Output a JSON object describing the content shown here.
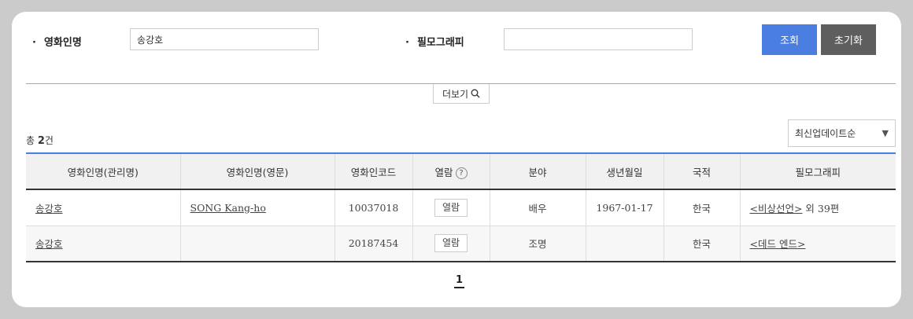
{
  "search": {
    "name_label": "영화인명",
    "name_value": "송강호",
    "filmo_label": "필모그래피",
    "filmo_value": "",
    "search_button": "조회",
    "reset_button": "초기화"
  },
  "more": {
    "label": "더보기",
    "icon": "search-icon"
  },
  "summary": {
    "prefix": "총",
    "count": "2",
    "suffix": "건"
  },
  "sort": {
    "selected": "최신업데이트순",
    "icon": "triangle-down-icon"
  },
  "table": {
    "headers": [
      "영화인명(관리명)",
      "영화인명(영문)",
      "영화인코드",
      "열람",
      "분야",
      "생년월일",
      "국적",
      "필모그래피"
    ],
    "help_icon": "?",
    "rows": [
      {
        "name": "송강호",
        "name_en": "SONG Kang-ho",
        "code": "10037018",
        "view": "열람",
        "field": "배우",
        "birth": "1967-01-17",
        "nation": "한국",
        "filmo_link": "<비상선언>",
        "filmo_extra": " 외 39편"
      },
      {
        "name": "송강호",
        "name_en": "",
        "code": "20187454",
        "view": "열람",
        "field": "조명",
        "birth": "",
        "nation": "한국",
        "filmo_link": "<데드 엔드>",
        "filmo_extra": ""
      }
    ]
  },
  "pagination": {
    "current": "1"
  },
  "colors": {
    "accent": "#4a7ee0",
    "reset": "#5e5e5e"
  }
}
